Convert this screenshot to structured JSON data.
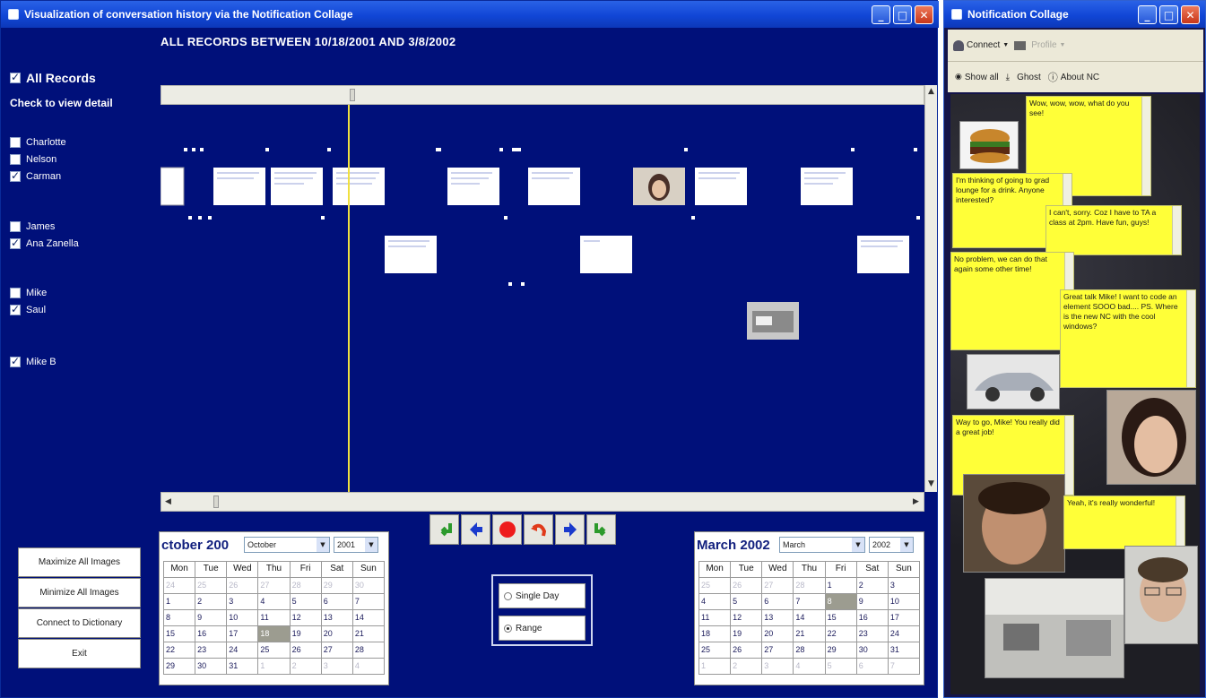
{
  "main_window": {
    "title": "Visualization of conversation history via the Notification Collage",
    "header": "ALL RECORDS BETWEEN 10/18/2001 AND 3/8/2002"
  },
  "left_panel": {
    "all_records_label": "All Records",
    "check_detail_label": "Check to view detail",
    "people": [
      {
        "name": "Charlotte",
        "checked": false
      },
      {
        "name": "Nelson",
        "checked": false
      },
      {
        "name": "Carman",
        "checked": true
      },
      {
        "name": "James",
        "checked": false
      },
      {
        "name": "Ana Zanella",
        "checked": true
      },
      {
        "name": "Mike",
        "checked": false
      },
      {
        "name": "Saul",
        "checked": true
      },
      {
        "name": "Mike B",
        "checked": true
      }
    ],
    "buttons": {
      "maximize": "Maximize All Images",
      "minimize": "Minimize All Images",
      "dictionary": "Connect to Dictionary",
      "exit": "Exit"
    }
  },
  "calendar_left": {
    "title": "ctober 200",
    "month": "October",
    "year": "2001",
    "weekdays": [
      "Mon",
      "Tue",
      "Wed",
      "Thu",
      "Fri",
      "Sat",
      "Sun"
    ],
    "selected_day": "18"
  },
  "calendar_right": {
    "title": "March 2002",
    "month": "March",
    "year": "2002",
    "weekdays": [
      "Mon",
      "Tue",
      "Wed",
      "Thu",
      "Fri",
      "Sat",
      "Sun"
    ],
    "selected_day": "8"
  },
  "range": {
    "single_day": "Single Day",
    "range": "Range",
    "selected": "range"
  },
  "nav_icons": [
    "enter-left-icon",
    "arrow-left-icon",
    "stop-icon",
    "undo-icon",
    "arrow-right-icon",
    "enter-right-icon"
  ],
  "nc_window": {
    "title": "Notification Collage",
    "toolbar1": {
      "connect": "Connect",
      "profile": "Profile"
    },
    "toolbar2": {
      "show_all": "Show all",
      "ghost": "Ghost",
      "about": "About NC"
    },
    "notes": [
      "Wow, wow, wow, what do you see!",
      "I'm thinking of going to grad lounge for a drink. Anyone interested?",
      "I can't, sorry. Coz I have to TA a class at 2pm. Have fun, guys!",
      "No problem, we can do that again some other time!",
      "Great talk Mike! I want to code an element SOOO bad.... PS. Where is the new NC with the cool windows?",
      "Way to go, Mike! You really did a great job!",
      "Yeah, it's really wonderful!"
    ]
  },
  "colors": {
    "background_blue": "#00107a",
    "timeline_marker": "#f0e040",
    "note_yellow": "#ffff38",
    "calendar_title": "#12207e"
  }
}
